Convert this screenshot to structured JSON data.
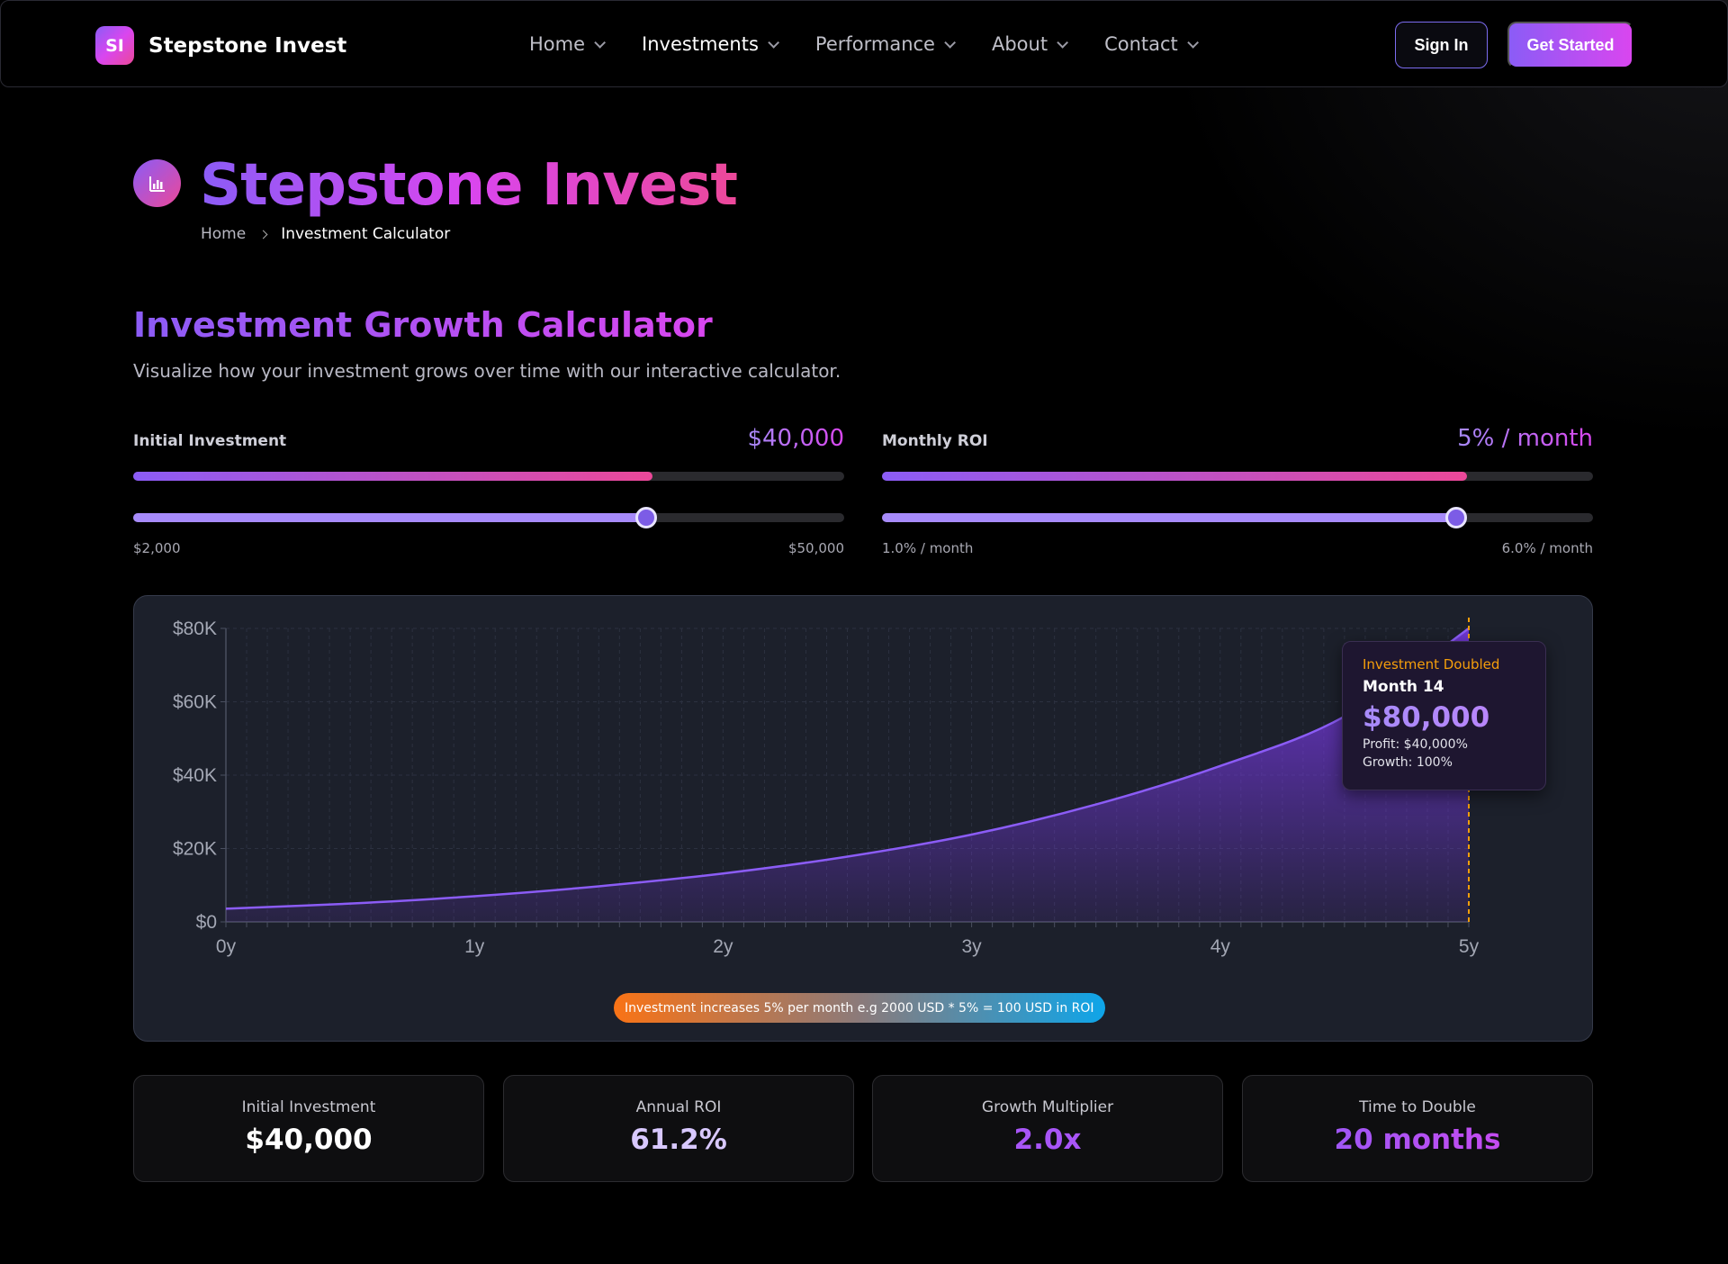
{
  "nav": {
    "brand_logo_text": "SI",
    "brand_name": "Stepstone Invest",
    "items": [
      {
        "label": "Home"
      },
      {
        "label": "Investments"
      },
      {
        "label": "Performance"
      },
      {
        "label": "About"
      },
      {
        "label": "Contact"
      }
    ],
    "sign_in": "Sign In",
    "get_started": "Get Started"
  },
  "hero": {
    "title": "Stepstone Invest",
    "breadcrumb": {
      "home": "Home",
      "current": "Investment Calculator"
    }
  },
  "calculator": {
    "title": "Investment Growth Calculator",
    "subtitle": "Visualize how your investment grows over time with our interactive calculator.",
    "initial": {
      "label": "Initial Investment",
      "value": "$40,000",
      "min_label": "$2,000",
      "max_label": "$50,000",
      "bar_progress": 0.73,
      "slider_progress": 0.722
    },
    "roi": {
      "label": "Monthly ROI",
      "value": "5% / month",
      "min_label": "1.0% / month",
      "max_label": "6.0% / month",
      "bar_progress": 0.823,
      "slider_progress": 0.808
    }
  },
  "chart_data": {
    "type": "area",
    "x_ticks": [
      "0y",
      "1y",
      "2y",
      "3y",
      "4y",
      "5y"
    ],
    "y_ticks": [
      "$0",
      "$20K",
      "$40K",
      "$60K",
      "$80K"
    ],
    "ylim": [
      0,
      80000
    ],
    "xlim": [
      0,
      5
    ],
    "grid": true,
    "series": [
      {
        "x": [
          0,
          0.5,
          1,
          1.5,
          2,
          2.5,
          3,
          3.5,
          4,
          4.5,
          5
        ],
        "values": [
          3600,
          5000,
          7000,
          9700,
          13200,
          17800,
          23800,
          32000,
          42500,
          56000,
          80000
        ]
      }
    ],
    "marker_x": 5,
    "tooltip": {
      "label": "Investment Doubled",
      "month": "Month 14",
      "value": "$80,000",
      "profit": "Profit: $40,000%",
      "growth": "Growth: 100%"
    },
    "note": "Investment increases 5% per month e.g 2000 USD * 5% = 100 USD in ROI",
    "colors": {
      "line": "#8b5cf6",
      "fill": "#7c3aed",
      "marker": "#f59e0b"
    }
  },
  "stats": [
    {
      "label": "Initial Investment",
      "value": "$40,000"
    },
    {
      "label": "Annual ROI",
      "value": "61.2%"
    },
    {
      "label": "Growth Multiplier",
      "value": "2.0x"
    },
    {
      "label": "Time to Double",
      "value": "20 months"
    }
  ]
}
